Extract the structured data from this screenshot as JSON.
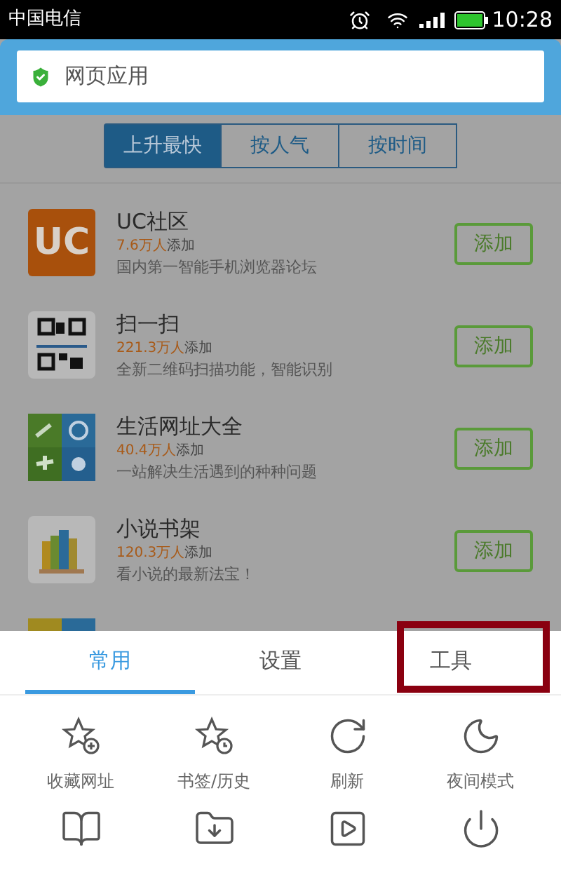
{
  "status_bar": {
    "carrier": "中国电信",
    "time": "10:28"
  },
  "search": {
    "value": "网页应用"
  },
  "segments": [
    {
      "label": "上升最快",
      "selected": true
    },
    {
      "label": "按人气",
      "selected": false
    },
    {
      "label": "按时间",
      "selected": false
    }
  ],
  "apps": [
    {
      "kind": "badge",
      "icon_text": "UC",
      "name": "UC社区",
      "count": "7.6万人",
      "count_suffix": "添加",
      "description": "国内第一智能手机浏览器论坛",
      "action": "添加"
    },
    {
      "kind": "qr",
      "name": "扫一扫",
      "count": "221.3万人",
      "count_suffix": "添加",
      "description": "全新二维码扫描功能，智能识别",
      "action": "添加"
    },
    {
      "kind": "grid",
      "name": "生活网址大全",
      "count": "40.4万人",
      "count_suffix": "添加",
      "description": "一站解决生活遇到的种种问题",
      "action": "添加"
    },
    {
      "kind": "books",
      "name": "小说书架",
      "count": "120.3万人",
      "count_suffix": "添加",
      "description": "看小说的最新法宝！",
      "action": "添加"
    },
    {
      "kind": "partial"
    }
  ],
  "menu_tabs": [
    {
      "label": "常用",
      "selected": true,
      "highlighted": false
    },
    {
      "label": "设置",
      "selected": false,
      "highlighted": false
    },
    {
      "label": "工具",
      "selected": false,
      "highlighted": true
    }
  ],
  "menu_items": [
    {
      "kind": "bookmark-add",
      "label": "收藏网址"
    },
    {
      "kind": "history",
      "label": "书签/历史"
    },
    {
      "kind": "refresh",
      "label": "刷新"
    },
    {
      "kind": "night",
      "label": "夜间模式"
    }
  ]
}
